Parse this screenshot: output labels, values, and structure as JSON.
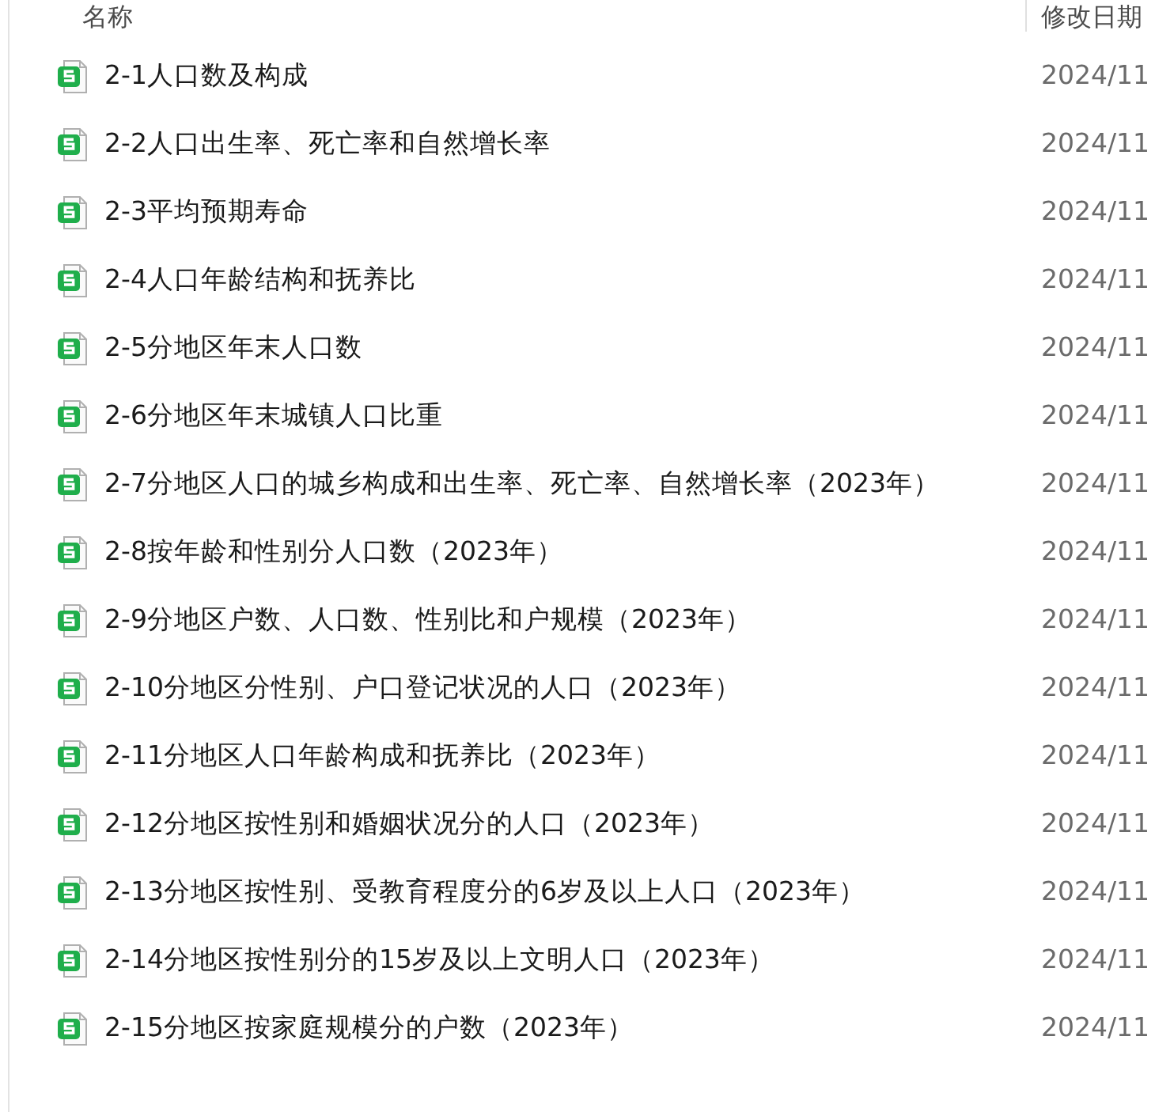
{
  "columns": [
    "名称",
    "修改日期"
  ],
  "files": [
    {
      "name": "2-1人口数及构成",
      "modified": "2024/11"
    },
    {
      "name": "2-2人口出生率、死亡率和自然增长率",
      "modified": "2024/11"
    },
    {
      "name": "2-3平均预期寿命",
      "modified": "2024/11"
    },
    {
      "name": "2-4人口年龄结构和抚养比",
      "modified": "2024/11"
    },
    {
      "name": "2-5分地区年末人口数",
      "modified": "2024/11"
    },
    {
      "name": "2-6分地区年末城镇人口比重",
      "modified": "2024/11"
    },
    {
      "name": "2-7分地区人口的城乡构成和出生率、死亡率、自然增长率（2023年）",
      "modified": "2024/11"
    },
    {
      "name": "2-8按年龄和性别分人口数（2023年）",
      "modified": "2024/11"
    },
    {
      "name": "2-9分地区户数、人口数、性别比和户规模（2023年）",
      "modified": "2024/11"
    },
    {
      "name": "2-10分地区分性别、户口登记状况的人口（2023年）",
      "modified": "2024/11"
    },
    {
      "name": "2-11分地区人口年龄构成和抚养比（2023年）",
      "modified": "2024/11"
    },
    {
      "name": "2-12分地区按性别和婚姻状况分的人口（2023年）",
      "modified": "2024/11"
    },
    {
      "name": "2-13分地区按性别、受教育程度分的6岁及以上人口（2023年）",
      "modified": "2024/11"
    },
    {
      "name": "2-14分地区按性别分的15岁及以上文明人口（2023年）",
      "modified": "2024/11"
    },
    {
      "name": "2-15分地区按家庭规模分的户数（2023年）",
      "modified": "2024/11"
    }
  ]
}
